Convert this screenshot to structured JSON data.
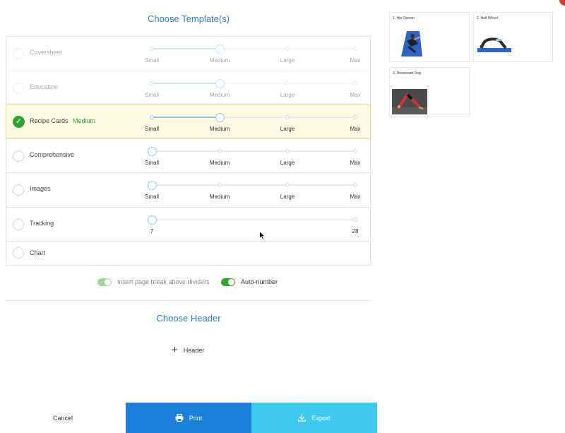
{
  "sections": {
    "templates_title": "Choose Template(s)",
    "header_title": "Choose Header"
  },
  "templates": [
    {
      "name": "Coversheet",
      "selected": false,
      "faded": true,
      "size": "",
      "slider_labels": [
        "Small",
        "Medium",
        "Large",
        "Max"
      ],
      "value_index": 1
    },
    {
      "name": "Education",
      "selected": false,
      "faded": true,
      "size": "",
      "slider_labels": [
        "Small",
        "Medium",
        "Large",
        "Max"
      ],
      "value_index": 1
    },
    {
      "name": "Recipe Cards",
      "selected": true,
      "faded": false,
      "size": "Medium",
      "slider_labels": [
        "Small",
        "Medium",
        "Large",
        "Max"
      ],
      "value_index": 1
    },
    {
      "name": "Comprehensive",
      "selected": false,
      "faded": false,
      "size": "",
      "slider_labels": [
        "Small",
        "Medium",
        "Large",
        "Max"
      ],
      "value_index": 0
    },
    {
      "name": "Images",
      "selected": false,
      "faded": false,
      "size": "",
      "slider_labels": [
        "Small",
        "Medium",
        "Large",
        "Max"
      ],
      "value_index": 0
    },
    {
      "name": "Tracking",
      "selected": false,
      "faded": false,
      "size": "",
      "slider_labels": [
        "7",
        "28"
      ],
      "value_index": 0
    },
    {
      "name": "Chart",
      "selected": false,
      "faded": false,
      "size": "",
      "slider_labels": [],
      "value_index": 0
    }
  ],
  "options": {
    "page_break_label": "Insert page break above dividers",
    "page_break_on": true,
    "page_break_disabled": true,
    "auto_number_label": "Auto-number",
    "auto_number_on": true
  },
  "header": {
    "add_label": "Header"
  },
  "footer": {
    "cancel_label": "Cancel",
    "print_label": "Print",
    "export_label": "Export"
  },
  "previews": [
    {
      "label": "1. Hip Opener"
    },
    {
      "label": "2. Half Wheel"
    },
    {
      "label": "3. Downward Dog"
    }
  ],
  "colors": {
    "accent_blue": "#2a7ec8",
    "selected_green": "#2fa32f",
    "print_blue": "#1a7fd8",
    "export_cyan": "#3ec9ef",
    "selected_row_bg": "#fdfbe3"
  }
}
